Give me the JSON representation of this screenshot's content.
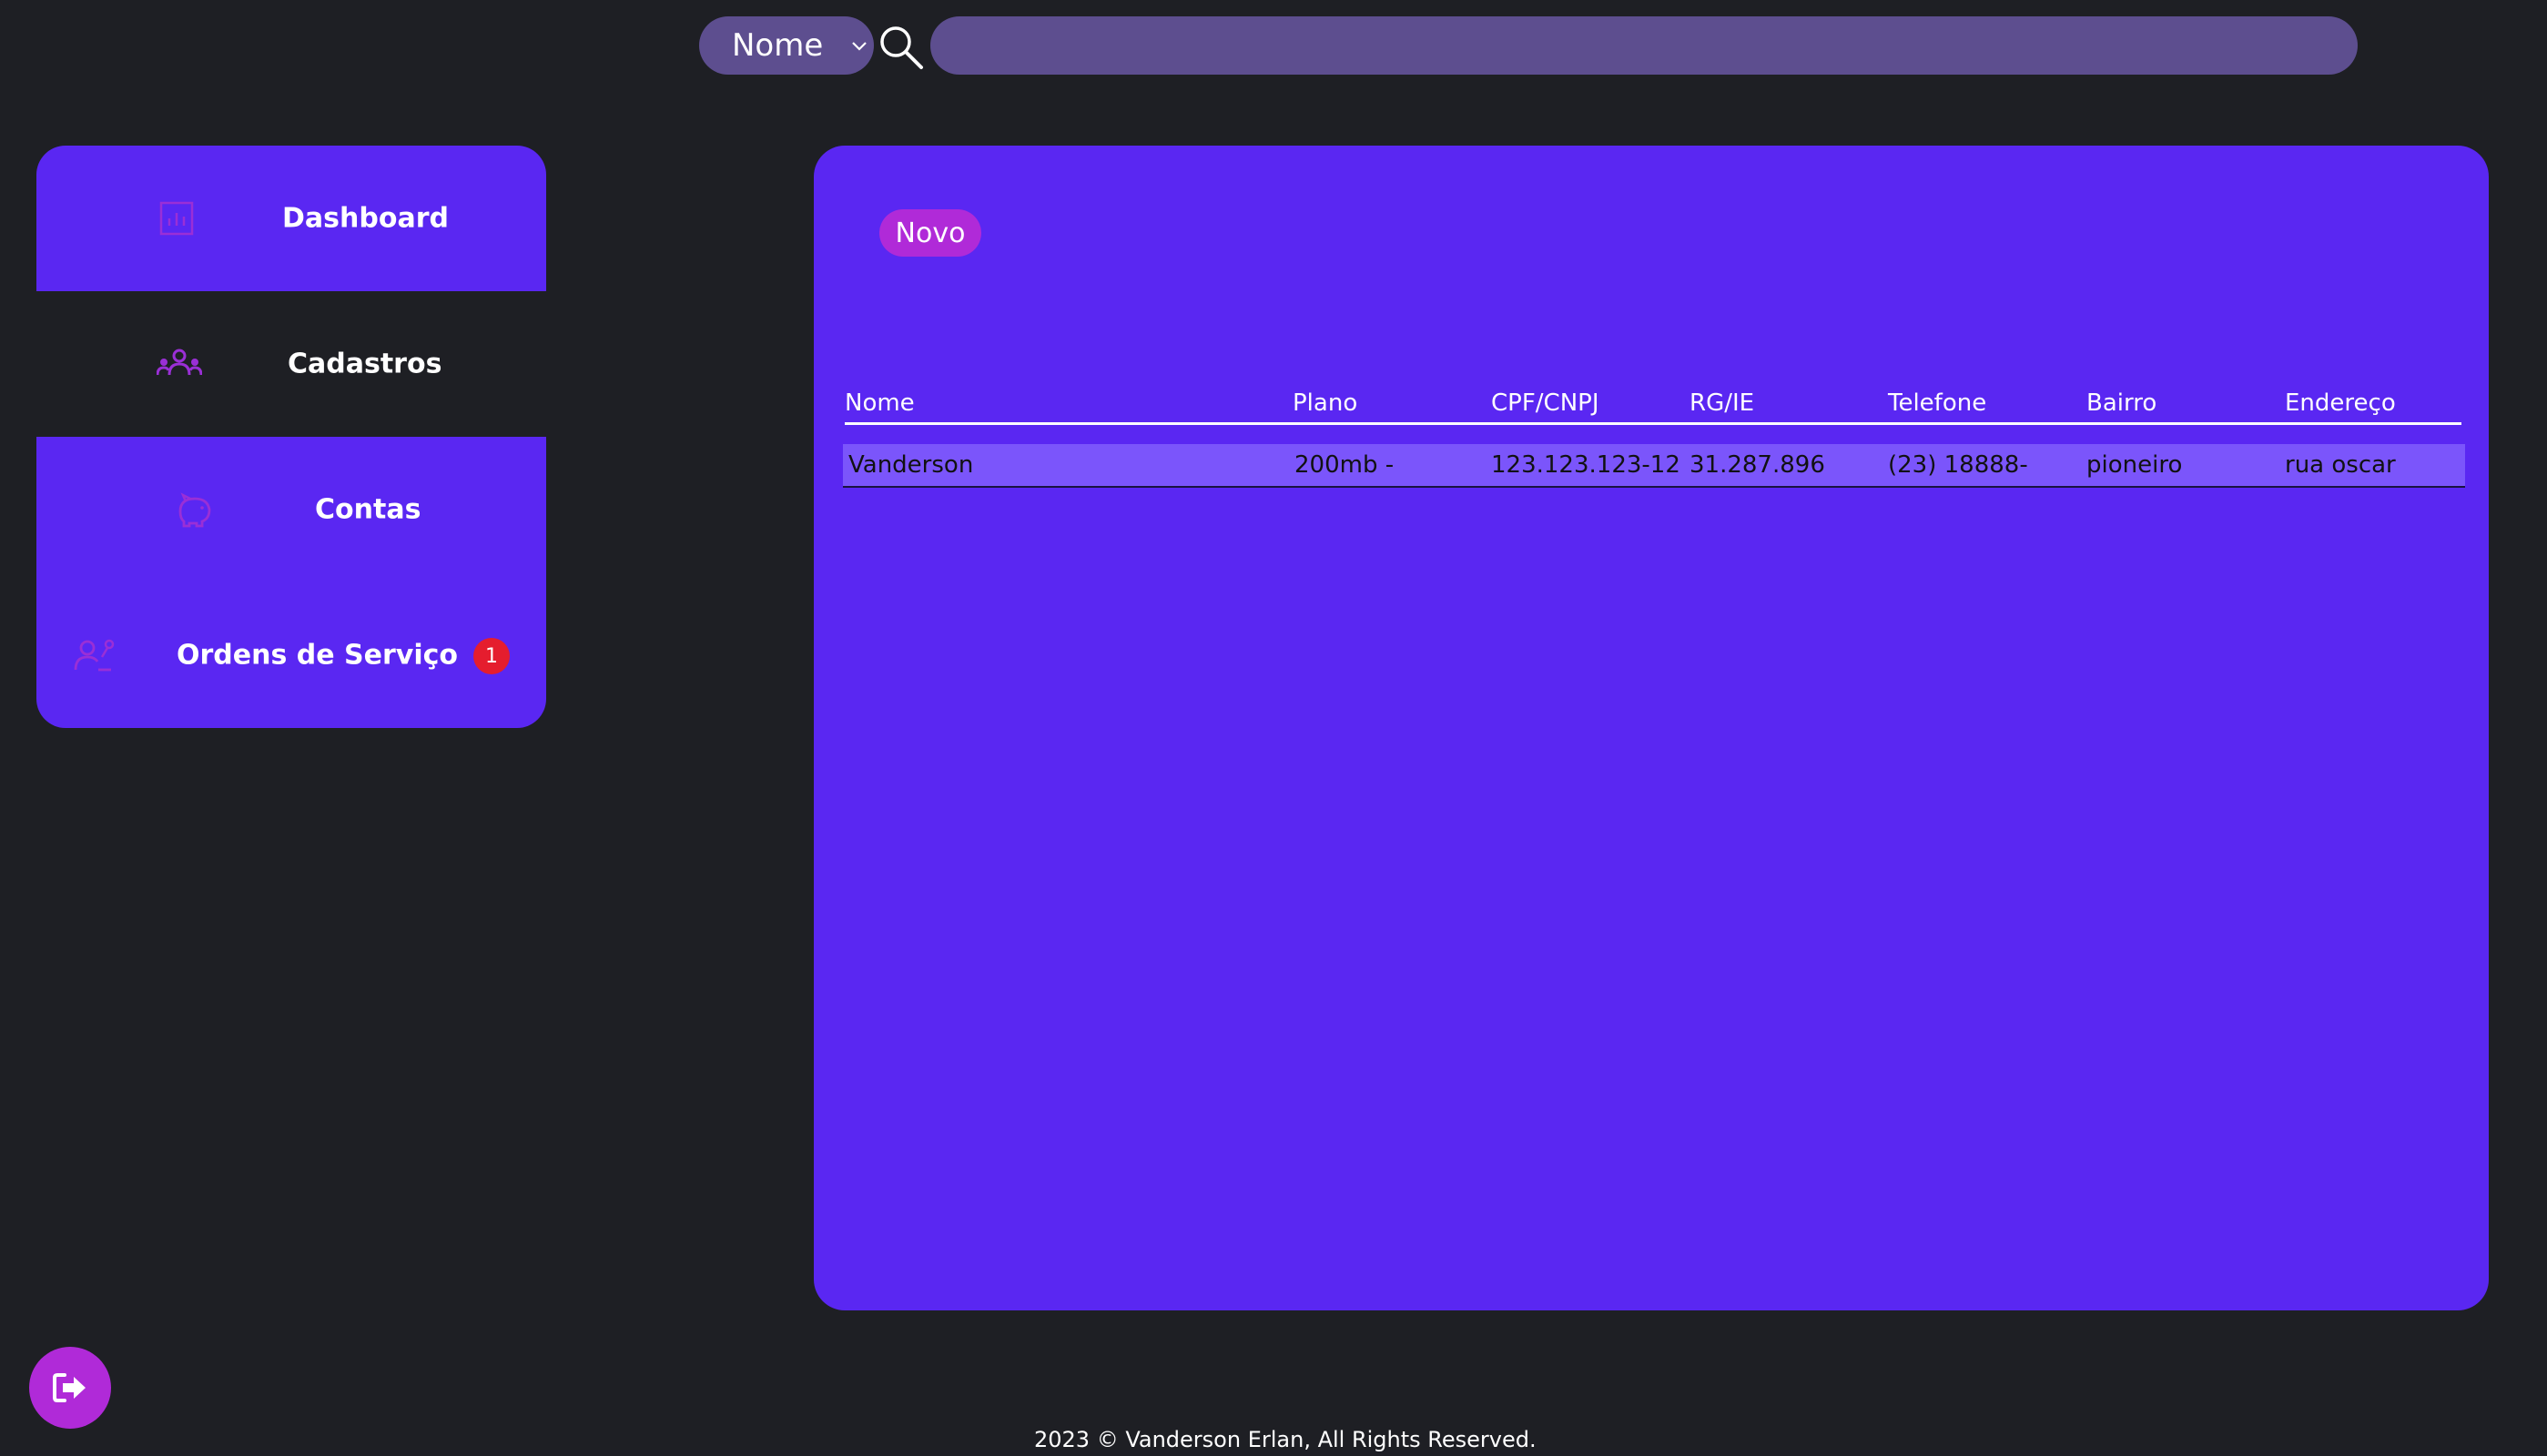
{
  "search": {
    "field_selected": "Nome",
    "query_value": ""
  },
  "sidebar": {
    "items": [
      {
        "label": "Dashboard",
        "icon": "chart-icon"
      },
      {
        "label": "Cadastros",
        "icon": "users-group-icon"
      },
      {
        "label": "Contas",
        "icon": "piggy-bank-icon"
      },
      {
        "label": "Ordens de Serviço",
        "icon": "user-settings-icon",
        "badge": "1"
      }
    ]
  },
  "main": {
    "new_button_label": "Novo",
    "table": {
      "headers": [
        "Nome",
        "Plano",
        "CPF/CNPJ",
        "RG/IE",
        "Telefone",
        "Bairro",
        "Endereço"
      ],
      "rows": [
        [
          "Vanderson",
          "200mb -",
          "123.123.123-12",
          "31.287.896",
          "(23) 18888-",
          "pioneiro",
          "rua oscar"
        ]
      ]
    }
  },
  "footer": {
    "text": "2023 © Vanderson Erlan, All Rights Reserved."
  },
  "colors": {
    "background": "#1e1f24",
    "primary_purple": "#5a27f2",
    "accent_magenta": "#b02ad8",
    "search_bg": "#5d4e8f",
    "row_highlight": "#7b55fb",
    "badge_red": "#e51d2e"
  }
}
